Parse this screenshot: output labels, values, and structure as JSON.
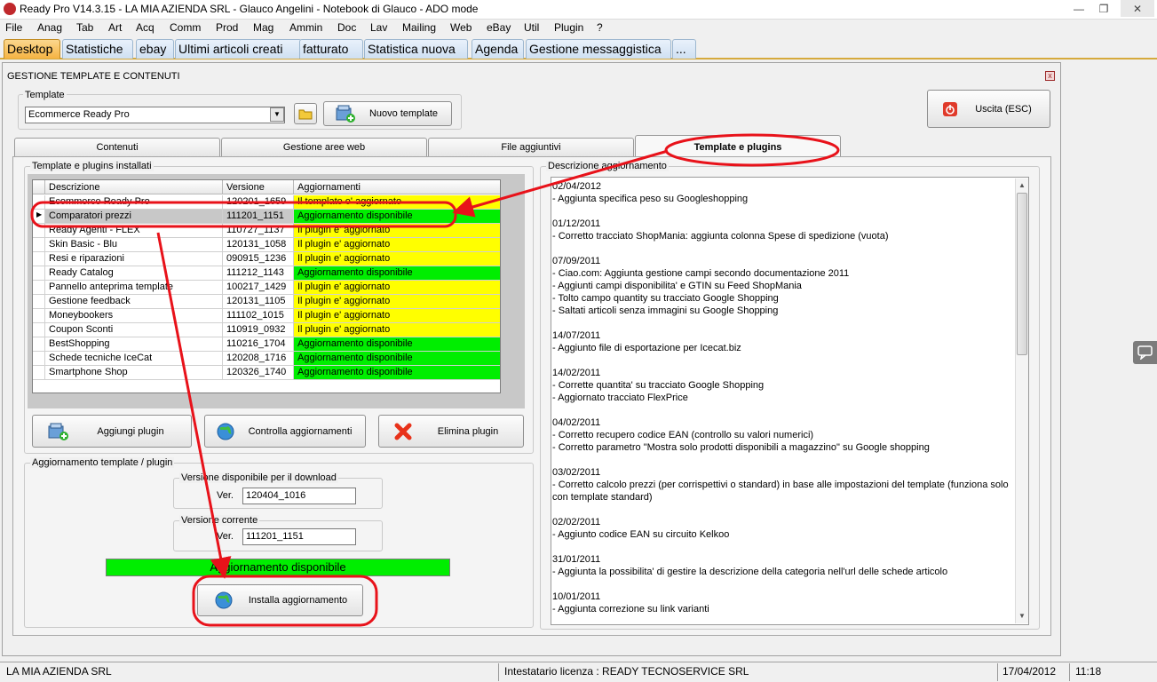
{
  "window": {
    "title": "Ready Pro V14.3.15 - LA MIA AZIENDA SRL - Glauco Angelini - Notebook di Glauco - ADO mode"
  },
  "menu": [
    "File",
    "Anag",
    "Tab",
    "Art",
    "Acq",
    "Comm",
    "Prod",
    "Mag",
    "Ammin",
    "Doc",
    "Lav",
    "Mailing",
    "Web",
    "eBay",
    "Util",
    "Plugin",
    "?"
  ],
  "tabs": [
    "Desktop",
    "Statistiche",
    "ebay",
    "Ultimi articoli creati",
    "fatturato",
    "Statistica nuova",
    "Agenda",
    "Gestione messaggistica",
    "..."
  ],
  "panel": {
    "title": "GESTIONE TEMPLATE E CONTENUTI",
    "template_group_label": "Template",
    "template_value": "Ecommerce Ready Pro",
    "new_template_button": "Nuovo template",
    "exit_button": "Uscita (ESC)"
  },
  "subtabs": [
    "Contenuti",
    "Gestione aree web",
    "File aggiuntivi",
    "Template e plugins"
  ],
  "installed": {
    "group_label": "Template e plugins installati",
    "headers": [
      "Descrizione",
      "Versione",
      "Aggiornamenti"
    ],
    "rows": [
      {
        "name": "Ecommerce Ready Pro",
        "version": "120201_1659",
        "status": "Il template e' aggiornato",
        "color": "yellow"
      },
      {
        "name": "Comparatori prezzi",
        "version": "111201_1151",
        "status": "Aggiornamento disponibile",
        "color": "green",
        "selected": true
      },
      {
        "name": "Ready Agenti - FLEX",
        "version": "110727_1137",
        "status": "Il plugin e' aggiornato",
        "color": "yellow"
      },
      {
        "name": "Skin Basic - Blu",
        "version": "120131_1058",
        "status": "Il plugin e' aggiornato",
        "color": "yellow"
      },
      {
        "name": "Resi e riparazioni",
        "version": "090915_1236",
        "status": "Il plugin e' aggiornato",
        "color": "yellow"
      },
      {
        "name": "Ready Catalog",
        "version": "111212_1143",
        "status": "Aggiornamento disponibile",
        "color": "green"
      },
      {
        "name": "Pannello anteprima template",
        "version": "100217_1429",
        "status": "Il plugin e' aggiornato",
        "color": "yellow"
      },
      {
        "name": "Gestione feedback",
        "version": "120131_1105",
        "status": "Il plugin e' aggiornato",
        "color": "yellow"
      },
      {
        "name": "Moneybookers",
        "version": "111102_1015",
        "status": "Il plugin e' aggiornato",
        "color": "yellow"
      },
      {
        "name": "Coupon Sconti",
        "version": "110919_0932",
        "status": "Il plugin e' aggiornato",
        "color": "yellow"
      },
      {
        "name": "BestShopping",
        "version": "110216_1704",
        "status": "Aggiornamento disponibile",
        "color": "green"
      },
      {
        "name": "Schede tecniche IceCat",
        "version": "120208_1716",
        "status": "Aggiornamento disponibile",
        "color": "green"
      },
      {
        "name": "Smartphone Shop",
        "version": "120326_1740",
        "status": "Aggiornamento disponibile",
        "color": "green"
      }
    ],
    "buttons": [
      "Aggiungi plugin",
      "Controlla aggiornamenti",
      "Elimina plugin"
    ]
  },
  "update": {
    "group_label": "Aggiornamento template / plugin",
    "available_label": "Versione disponibile per il download",
    "current_label": "Versione corrente",
    "ver_label": "Ver.",
    "available_version": "120404_1016",
    "current_version": "111201_1151",
    "status_text": "Aggiornamento disponibile",
    "install_button": "Installa aggiornamento"
  },
  "description": {
    "label": "Descrizione aggiornamento",
    "text": "02/04/2012\n- Aggiunta specifica peso su Googleshopping\n\n01/12/2011\n- Corretto tracciato ShopMania: aggiunta colonna Spese di spedizione (vuota)\n\n07/09/2011\n- Ciao.com: Aggiunta gestione campi secondo documentazione 2011\n- Aggiunti campi disponibilita' e GTIN su Feed ShopMania\n- Tolto campo quantity su tracciato Google Shopping\n- Saltati articoli senza immagini su Google Shopping\n\n14/07/2011\n- Aggiunto file di esportazione per Icecat.biz\n\n14/02/2011\n- Corrette quantita' su tracciato Google Shopping\n- Aggiornato tracciato FlexPrice\n\n04/02/2011\n- Corretto recupero codice EAN (controllo su valori numerici)\n- Corretto parametro \"Mostra solo prodotti disponibili a magazzino\" su Google shopping\n\n03/02/2011\n- Corretto calcolo prezzi (per corrispettivi o standard) in base alle impostazioni del template (funziona solo con template standard)\n\n02/02/2011\n- Aggiunto codice EAN su circuito Kelkoo\n\n31/01/2011\n- Aggiunta la possibilita' di gestire la descrizione della categoria nell'url delle schede articolo\n\n10/01/2011\n- Aggiunta correzione su link varianti"
  },
  "status": {
    "company": "LA MIA AZIENDA SRL",
    "license": "Intestatario licenza : READY TECNOSERVICE SRL",
    "date": "17/04/2012",
    "time": "11:18"
  },
  "colors": {
    "yellow": "#ffff00",
    "green": "#00ee00",
    "annotation": "#e8121a",
    "tab_active": "#f5b342"
  },
  "icons": [
    "app-icon",
    "folder-icon",
    "new-template-icon",
    "power-icon",
    "add-plugin-icon",
    "globe-refresh-icon",
    "delete-x-icon",
    "globe-install-icon",
    "chat-icon"
  ]
}
